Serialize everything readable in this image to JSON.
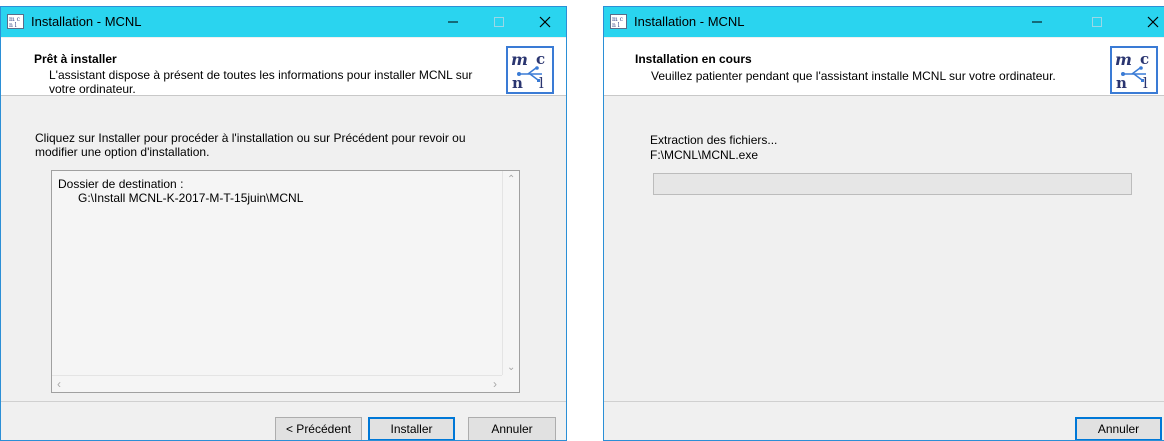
{
  "windows": [
    {
      "title": "Installation - MCNL",
      "header": {
        "title": "Prêt à installer",
        "subtitle_line1": "L'assistant dispose à présent de toutes les informations pour installer MCNL sur",
        "subtitle_line2": "votre ordinateur."
      },
      "body": {
        "line1": "Cliquez sur Installer pour procéder à l'installation ou sur Précédent pour revoir ou",
        "line2": "modifier une option d'installation."
      },
      "memo": {
        "label": "Dossier de destination :",
        "path": "G:\\Install MCNL-K-2017-M-T-15juin\\MCNL"
      },
      "buttons": {
        "back": "< Précédent",
        "install": "Installer",
        "cancel": "Annuler"
      }
    },
    {
      "title": "Installation - MCNL",
      "header": {
        "title": "Installation en cours",
        "subtitle": "Veuillez patienter pendant que l'assistant installe MCNL sur votre ordinateur."
      },
      "status": {
        "label": "Extraction des fichiers...",
        "file": "F:\\MCNL\\MCNL.exe",
        "progress": 0
      },
      "buttons": {
        "cancel": "Annuler"
      }
    }
  ],
  "colors": {
    "titlebar": "#2ad4ef",
    "accent": "#0078d7",
    "logo_border": "#3a7bd5"
  }
}
